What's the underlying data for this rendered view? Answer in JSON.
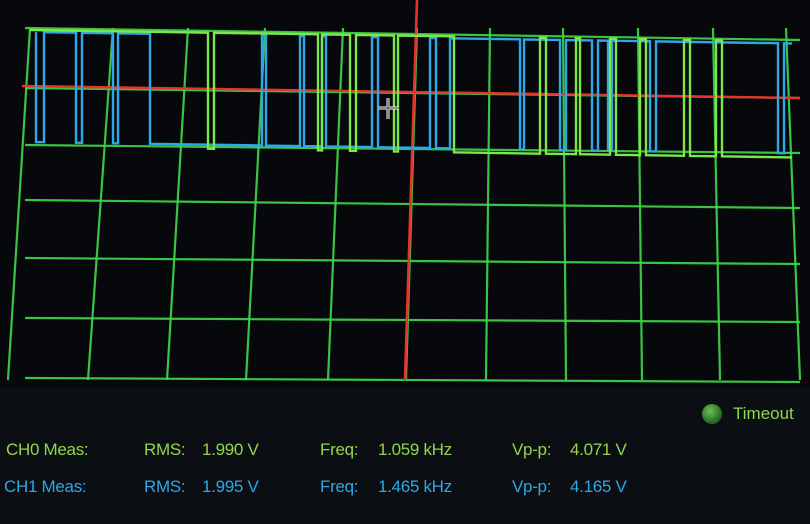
{
  "colors": {
    "grid": "#3fd94a",
    "cursor": "#e8332c",
    "ch0_trace": "#7ee64a",
    "ch1_trace": "#2fa6e6",
    "background": "#0b0e12"
  },
  "status": {
    "indicator_icon": "status-led-icon",
    "label": "Timeout"
  },
  "measurements": [
    {
      "channel": "CH0 Meas:",
      "rms_label": "RMS:",
      "rms_value": "1.990 V",
      "freq_label": "Freq:",
      "freq_value": "1.059 kHz",
      "vpp_label": "Vp-p:",
      "vpp_value": "4.071 V"
    },
    {
      "channel": "CH1 Meas:",
      "rms_label": "RMS:",
      "rms_value": "1.995 V",
      "freq_label": "Freq:",
      "freq_value": "1.465 kHz",
      "vpp_label": "Vp-p:",
      "vpp_value": "4.165 V"
    }
  ]
}
